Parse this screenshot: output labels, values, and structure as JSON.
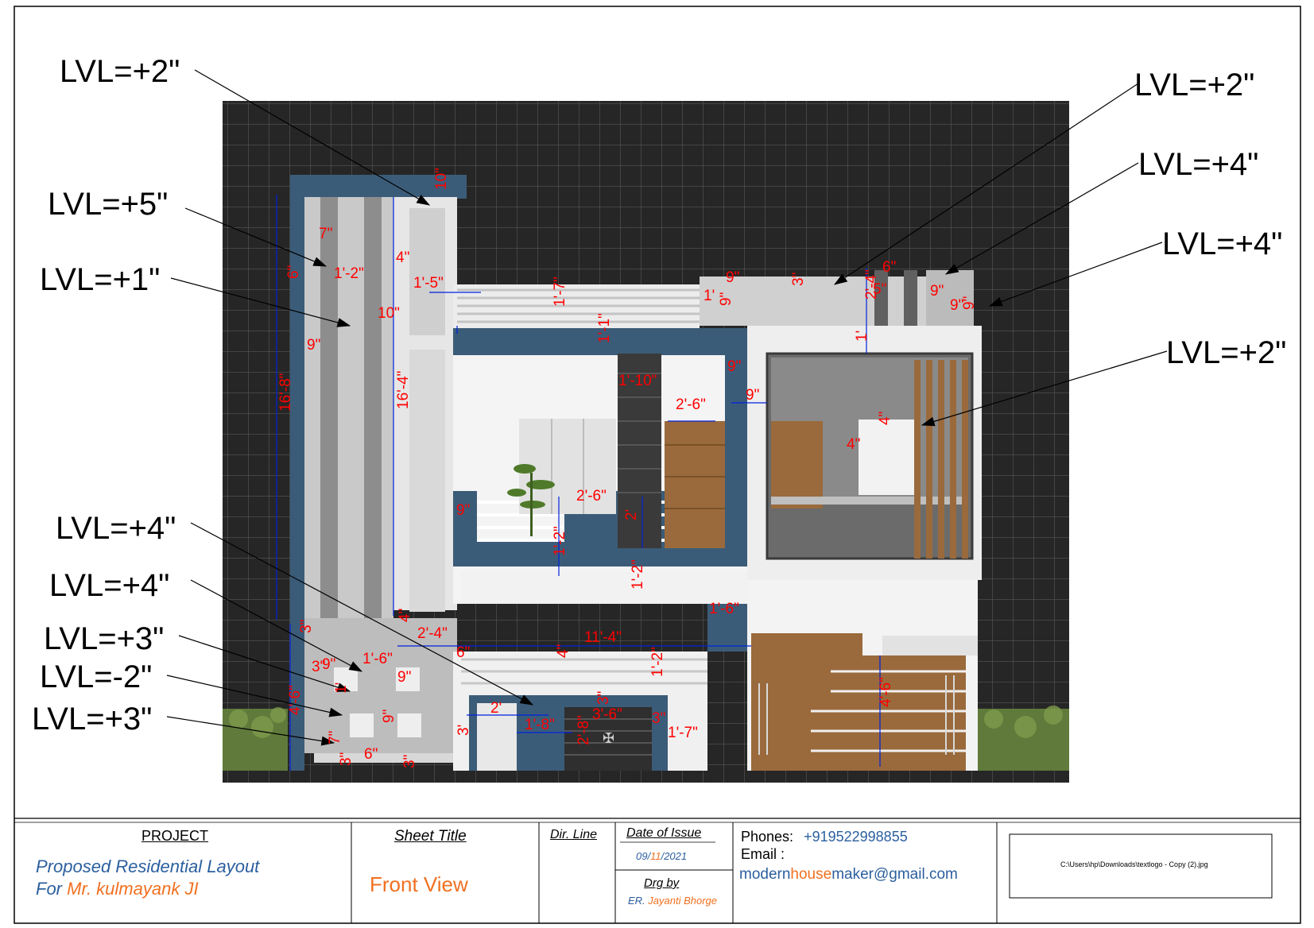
{
  "drawing": {
    "level_labels": [
      {
        "id": "lvl-1",
        "text": "LVL=+2\""
      },
      {
        "id": "lvl-2",
        "text": "LVL=+5\""
      },
      {
        "id": "lvl-3",
        "text": "LVL=+1\""
      },
      {
        "id": "lvl-4",
        "text": "LVL=+2\""
      },
      {
        "id": "lvl-5",
        "text": "LVL=+4\""
      },
      {
        "id": "lvl-6",
        "text": "LVL=+4\""
      },
      {
        "id": "lvl-7",
        "text": "LVL=+2\""
      },
      {
        "id": "lvl-8",
        "text": "LVL=+4\""
      },
      {
        "id": "lvl-9",
        "text": "LVL=+4\""
      },
      {
        "id": "lvl-10",
        "text": "LVL=+3\""
      },
      {
        "id": "lvl-11",
        "text": "LVL=-2\""
      },
      {
        "id": "lvl-12",
        "text": "LVL=+3\""
      }
    ],
    "dimensions": [
      "10\"",
      "7\"",
      "6\"",
      "1'-2\"",
      "4\"",
      "1'-5\"",
      "16'-8\"",
      "16'-4\"",
      "10\"",
      "9\"",
      "1'-7\"",
      "1'",
      "9\"",
      "9\"",
      "3\"",
      "6\"",
      "2'-4\"",
      "5\"",
      "9\"",
      "9\"",
      "9\"",
      "1'",
      "1'-1\"",
      "1'-10\"",
      "2'-6\"",
      "9\"",
      "9\"",
      "4\"",
      "4\"",
      "2'-6\"",
      "9\"",
      "2'",
      "1'-2\"",
      "1'-2\"",
      "1'-6\"",
      "4\"",
      "2'-4\"",
      "11'-4\"",
      "3\"",
      "6\"",
      "1'-6\"",
      "9\"",
      "4\"",
      "1'-2\"",
      "3\"",
      "1'",
      "4'-6\"",
      "9\"",
      "9\"",
      "2'",
      "1'-8\"",
      "3'-6\"",
      "3\"",
      "3\"",
      "3'",
      "2'-8\"",
      "7\"",
      "6\"",
      "3\"",
      "3\"",
      "1'-7\"",
      "4'-6\""
    ],
    "colors": {
      "background": "#2b2b2b",
      "grid": "#4a4a4a",
      "navy": "#3b5c78",
      "dimension": "#ff0000",
      "wood": "#9a6a3c"
    }
  },
  "title_block": {
    "project_heading": "PROJECT",
    "project_line1": "Proposed Residential Layout",
    "project_line2_prefix": "For ",
    "project_line2_name": "Mr. kulmayank JI",
    "sheet_title_heading": "Sheet Title",
    "sheet_title_value": "Front View",
    "dir_line_heading": "Dir. Line",
    "date_heading": "Date of Issue",
    "date_dd": "09/",
    "date_mm": "11",
    "date_yyyy": "/2021",
    "drawn_by_heading": "Drg by",
    "drawn_by_prefix": "ER. ",
    "drawn_by_name": "Jayanti Bhorge",
    "phones_label": "Phones:",
    "phones_value": "+919522998855",
    "email_label": "Email :",
    "email_part1": "modern",
    "email_part2": "house",
    "email_part3": "maker@gmail.com",
    "logo_path": "C:\\Users\\hp\\Downloads\\textlogo - Copy (2).jpg",
    "colors": {
      "blue": "#2b5f9e",
      "orange": "#f07020"
    }
  }
}
